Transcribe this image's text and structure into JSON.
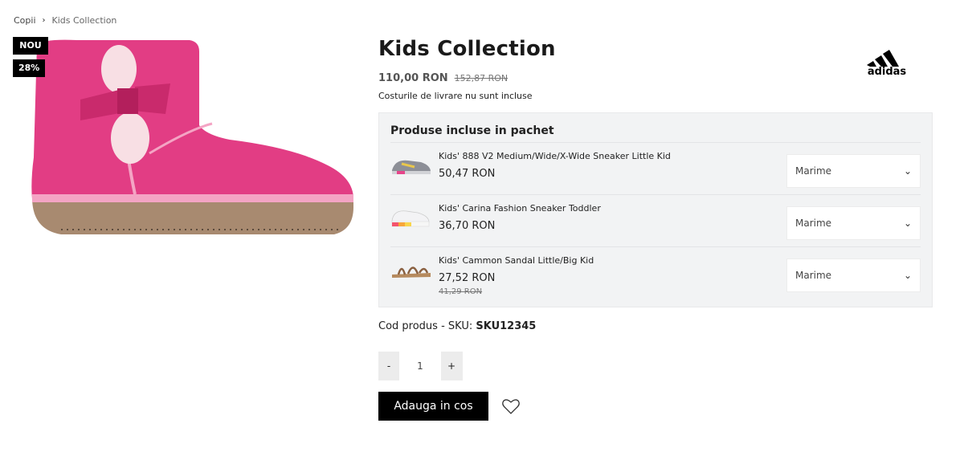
{
  "breadcrumb": {
    "parent": "Copii",
    "separator": "›",
    "current": "Kids Collection"
  },
  "badges": {
    "new": "NOU",
    "discount": "28%"
  },
  "product": {
    "title": "Kids Collection",
    "brand": "adidas",
    "price": "110,00 RON",
    "old_price": "152,87 RON",
    "shipping_note": "Costurile de livrare nu sunt incluse",
    "image_icon": "pink-boot-image",
    "colors": {
      "boot": "#e23d84",
      "sole": "#a88a70",
      "accent": "#000000"
    }
  },
  "bundle": {
    "title": "Produse incluse in pachet",
    "items": [
      {
        "name": "Kids' 888 V2 Medium/Wide/X-Wide Sneaker Little Kid",
        "price": "50,47 RON",
        "old_price": "",
        "size_label": "Marime"
      },
      {
        "name": "Kids' Carina Fashion Sneaker Toddler",
        "price": "36,70 RON",
        "old_price": "",
        "size_label": "Marime"
      },
      {
        "name": "Kids' Cammon Sandal Little/Big Kid",
        "price": "27,52 RON",
        "old_price": "41,29 RON",
        "size_label": "Marime"
      }
    ]
  },
  "sku": {
    "label": "Cod produs - SKU: ",
    "value": "SKU12345"
  },
  "quantity": {
    "minus": "-",
    "value": "1",
    "plus": "+"
  },
  "actions": {
    "add_to_cart": "Adauga in cos",
    "wishlist_icon": "heart-icon"
  }
}
